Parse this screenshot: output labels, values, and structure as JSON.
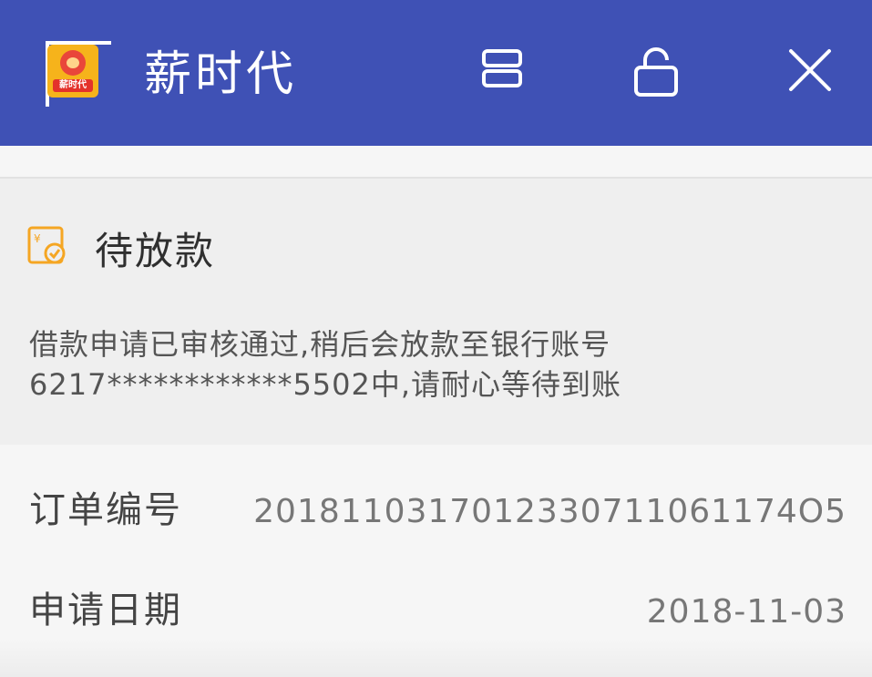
{
  "header": {
    "app_name": "薪时代",
    "logo_text": "薪时代",
    "icons": [
      "stack-icon",
      "unlock-icon",
      "close-icon"
    ],
    "bar_color": "#3f51b5"
  },
  "status": {
    "icon": "money-check-icon",
    "title": "待放款",
    "description_line1": "借款申请已审核通过,稍后会放款至银行账号",
    "description_line2": "6217************5502中,请耐心等待到账",
    "accent_color": "#f5a623"
  },
  "details": [
    {
      "label": "订单编号",
      "value": "2018110317012330711061174O5"
    },
    {
      "label": "申请日期",
      "value": "2018-11-03"
    }
  ]
}
